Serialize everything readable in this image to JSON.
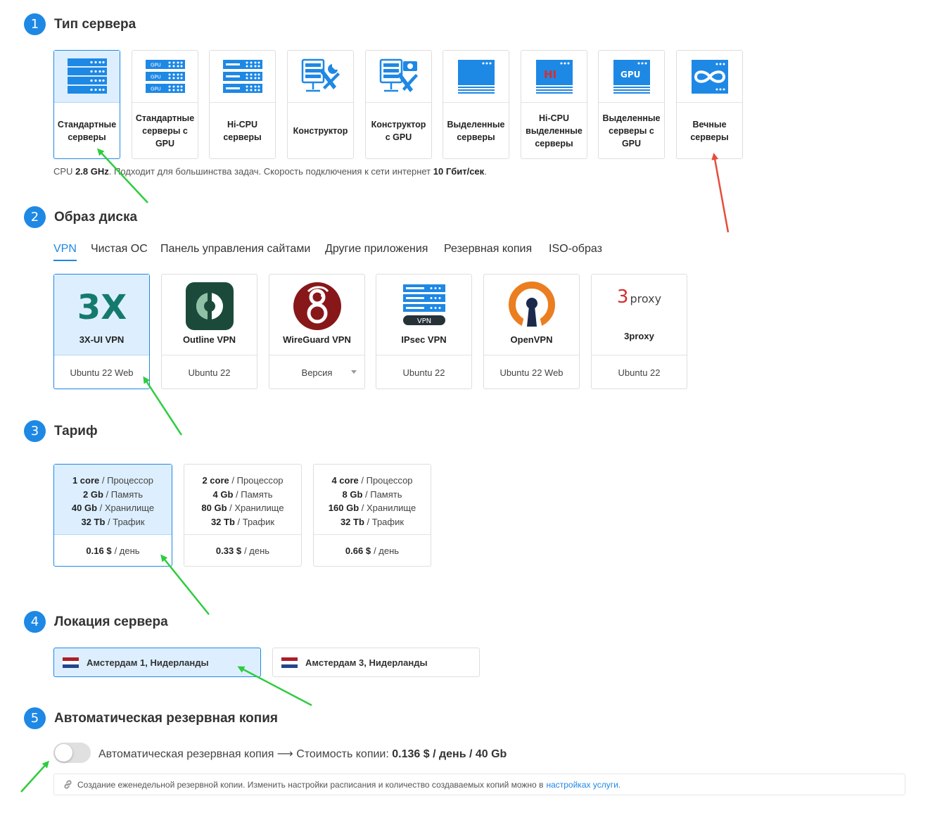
{
  "steps": [
    {
      "num": "1",
      "title": "Тип сервера"
    },
    {
      "num": "2",
      "title": "Образ диска"
    },
    {
      "num": "3",
      "title": "Тариф"
    },
    {
      "num": "4",
      "title": "Локация сервера"
    },
    {
      "num": "5",
      "title": "Автоматическая резервная копия"
    }
  ],
  "server_types": [
    {
      "label": "Стандартные серверы",
      "icon": "server-rack-icon",
      "selected": true
    },
    {
      "label": "Стандартные серверы с GPU",
      "icon": "gpu-server-rack-icon",
      "icon_text": "GPU"
    },
    {
      "label": "Hi-CPU серверы",
      "icon": "hicpu-server-rack-icon"
    },
    {
      "label": "Конструктор",
      "icon": "server-tools-icon"
    },
    {
      "label": "Конструктор с GPU",
      "icon": "server-tools-gpu-icon"
    },
    {
      "label": "Выделенные серверы",
      "icon": "dedicated-server-icon"
    },
    {
      "label": "Hi-CPU выделенные серверы",
      "icon": "hicpu-dedicated-server-icon",
      "icon_text": "HI"
    },
    {
      "label": "Выделенные серверы с GPU",
      "icon": "gpu-dedicated-server-icon",
      "icon_text": "GPU"
    },
    {
      "label": "Вечные серверы",
      "icon": "infinity-server-icon"
    }
  ],
  "server_desc": {
    "p1": "CPU ",
    "cpu": "2.8 GHz",
    "p2": ". Подходит для большинства задач. Скорость подключения к сети интернет ",
    "speed": "10 Гбит/сек",
    "p3": "."
  },
  "image_tabs": [
    "VPN",
    "Чистая ОС",
    "Панель управления сайтами",
    "Другие приложения",
    "Резервная копия",
    "ISO-образ"
  ],
  "images": [
    {
      "name": "3X-UI VPN",
      "os": "Ubuntu 22 Web",
      "logo": "3x-ui-logo",
      "logo_text": "3X",
      "selected": true
    },
    {
      "name": "Outline VPN",
      "os": "Ubuntu 22",
      "logo": "outline-logo"
    },
    {
      "name": "WireGuard VPN",
      "os": "Версия",
      "logo": "wireguard-logo",
      "dropdown": true
    },
    {
      "name": "IPsec VPN",
      "os": "Ubuntu 22",
      "logo": "ipsec-logo",
      "logo_text": "VPN"
    },
    {
      "name": "OpenVPN",
      "os": "Ubuntu 22 Web",
      "logo": "openvpn-logo"
    },
    {
      "name": "3proxy",
      "os": "Ubuntu 22",
      "logo": "3proxy-logo",
      "logo_num": "3",
      "logo_word": "proxy"
    }
  ],
  "tariffs": [
    {
      "cpu": "1 core",
      "cpu_l": " / Процессор",
      "ram": "2 Gb",
      "ram_l": " / Память",
      "disk": "40 Gb",
      "disk_l": " / Хранилище",
      "traffic": "32 Tb",
      "traffic_l": " / Трафик",
      "price": "0.16 $",
      "price_l": "/ день",
      "selected": true
    },
    {
      "cpu": "2 core",
      "cpu_l": " / Процессор",
      "ram": "4 Gb",
      "ram_l": " / Память",
      "disk": "80 Gb",
      "disk_l": " / Хранилище",
      "traffic": "32 Tb",
      "traffic_l": " / Трафик",
      "price": "0.33 $",
      "price_l": "/ день"
    },
    {
      "cpu": "4 core",
      "cpu_l": " / Процессор",
      "ram": "8 Gb",
      "ram_l": " / Память",
      "disk": "160 Gb",
      "disk_l": " / Хранилище",
      "traffic": "32 Tb",
      "traffic_l": " / Трафик",
      "price": "0.66 $",
      "price_l": "/ день"
    }
  ],
  "locations": [
    {
      "name": "Амстердам 1, Нидерланды",
      "flag": "netherlands-flag-icon",
      "selected": true
    },
    {
      "name": "Амстердам 3, Нидерланды",
      "flag": "netherlands-flag-icon"
    }
  ],
  "backup": {
    "enabled": false,
    "label": "Автоматическая резервная копия ⟶ Стоимость копии: ",
    "cost": "0.136 $ / день / 40 Gb",
    "info": "Создание еженедельной резервной копии. Изменить настройки расписания и количество создаваемых копий можно в",
    "info_link": "настройках услуги."
  },
  "colors": {
    "accent": "#1e88e5",
    "selected_bg": "#ddefff",
    "arrow_green": "#2ecc40",
    "arrow_red": "#e74c3c",
    "flag_red": "#ae1c28",
    "flag_blue": "#21468b",
    "openvpn_orange": "#ea7e20",
    "wireguard_red": "#88171a",
    "outline_green": "#1b4a3b",
    "xui_teal": "#157a6e"
  }
}
